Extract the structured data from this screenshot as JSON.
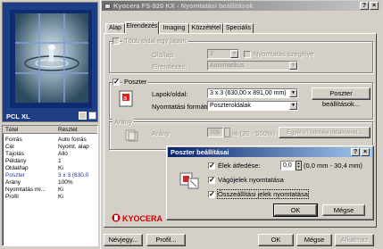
{
  "preview": {
    "label": "PCL XL"
  },
  "properties": {
    "headers": [
      "Tétel",
      "Részlet"
    ],
    "rows": [
      [
        "Forrás",
        "Auto forrás"
      ],
      [
        "Cél",
        "Nyomt. alap"
      ],
      [
        "Tájolás",
        "Álló"
      ],
      [
        "Példány",
        "1"
      ],
      [
        "Oldal/lap",
        "Ki"
      ],
      [
        "Poszter",
        "3 x 3 (630,0"
      ],
      [
        "Arány",
        "100%"
      ],
      [
        "Nyomtatás mi...",
        "Ki"
      ],
      [
        "Profil",
        "Ki"
      ]
    ]
  },
  "main_window": {
    "title": "Kyocera FS-920 KX - Nyomtatási beállítások",
    "help_btn": "?",
    "close_btn": "×"
  },
  "tabs": [
    "Alap",
    "Elrendezés",
    "Imaging",
    "Közzététel",
    "Speciális"
  ],
  "multi_page": {
    "checkbox_label": "Több oldal egy lapon",
    "pages_label": "Old/lap:",
    "pages_value": "2",
    "border_label": "Nyomtatás szegélye",
    "order_label": "Elrendezés:",
    "order_value": "Automatikus"
  },
  "poster": {
    "checkbox_label": "Poszter",
    "checked_mark": "✓",
    "sheets_label": "Lapok/oldal:",
    "sheets_value": "3 x 3 (630,00 x 891,00 mm)",
    "settings_button": "Poszter beállítások...",
    "format_label": "Nyomtatási formátum:",
    "format_value": "Poszteroldalak"
  },
  "scale": {
    "group_label": "Arány",
    "label": "Arány",
    "value": "100",
    "unit_text": "% (20 - 500%)",
    "custom_button": "Egyéni/Többféle oldalméret..."
  },
  "brand": "KYOCERA",
  "footer": {
    "defaults_button": "Névjegy...",
    "profile_button": "Profil...",
    "ok": "OK",
    "cancel": "Mégse",
    "apply": "Alkalmaz"
  },
  "poster_dialog": {
    "title": "Poszter beállításai",
    "help_btn": "?",
    "close_btn": "×",
    "overlap_label": "Élek átfedése:",
    "overlap_value": "0,0",
    "overlap_range": "(0,0 mm - 30,4 mm)",
    "cut_marks_label": "Vágójelek nyomtatása",
    "align_marks_label": "Összeállítási jelek nyomtatása",
    "ok": "OK",
    "cancel": "Mégse"
  }
}
